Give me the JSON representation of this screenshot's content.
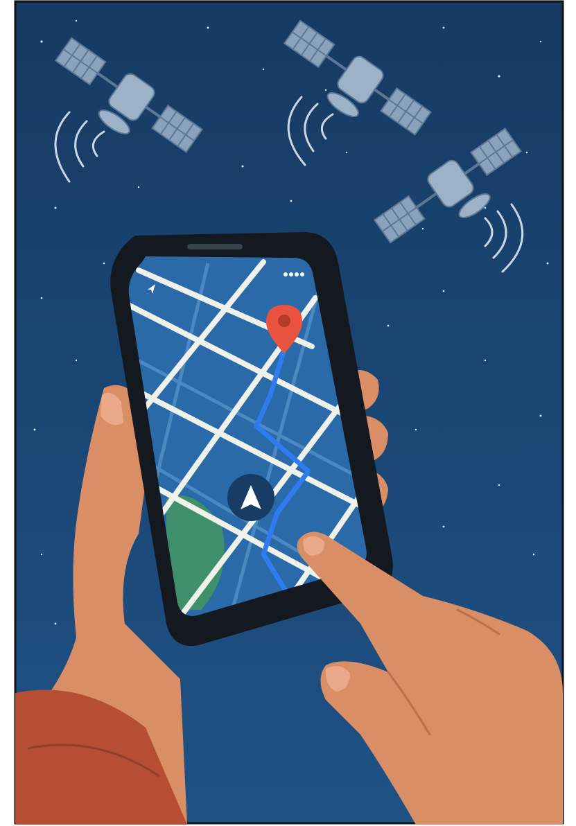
{
  "illustration": {
    "subject": "smartphone-gps-navigation-with-satellites",
    "satellites": [
      {
        "name": "satellite-top-left"
      },
      {
        "name": "satellite-top-right"
      },
      {
        "name": "satellite-right"
      }
    ],
    "phone_screen": {
      "status_icons": [
        "navigation-arrow-small-icon",
        "signal-dots-icon"
      ],
      "destination_marker": "location-pin-icon",
      "current_position_marker": "navigation-arrow-icon",
      "route_color": "#2f7bf0"
    }
  },
  "colors": {
    "sky": "#1e4b78",
    "sky_dark": "#163a63",
    "map_block": "#2a6aa8",
    "road": "#eef2ea",
    "park": "#3e8f6a",
    "pin": "#e8533f",
    "skin": "#d98e66",
    "sleeve": "#b54e33",
    "satellite": "#8aa3bd"
  }
}
